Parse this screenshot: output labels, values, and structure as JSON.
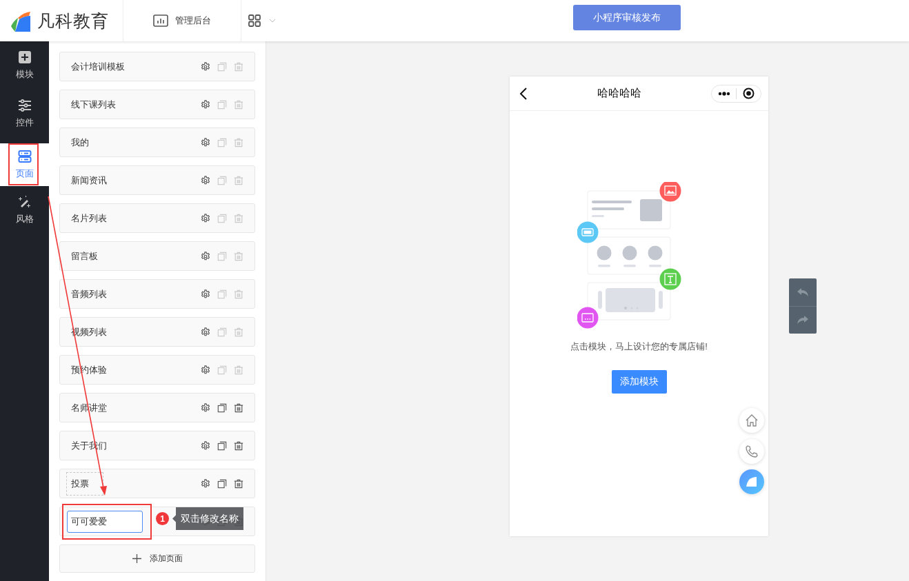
{
  "header": {
    "logo_text": "凡科教育",
    "nav": [
      {
        "label": "管理后台"
      }
    ],
    "publish_button": "小程序审核发布"
  },
  "sidebar": {
    "items": [
      {
        "label": "模块",
        "kind": "module",
        "selected": false
      },
      {
        "label": "控件",
        "kind": "control",
        "selected": false
      },
      {
        "label": "页面",
        "kind": "page",
        "selected": true
      },
      {
        "label": "风格",
        "kind": "style",
        "selected": false
      }
    ]
  },
  "pages": [
    {
      "name": "会计培训模板",
      "kind": "normal",
      "actions_disabled": true
    },
    {
      "name": "线下课列表",
      "kind": "normal",
      "actions_disabled": true
    },
    {
      "name": "我的",
      "kind": "normal",
      "actions_disabled": true
    },
    {
      "name": "新闻资讯",
      "kind": "normal",
      "actions_disabled": true
    },
    {
      "name": "名片列表",
      "kind": "normal",
      "actions_disabled": true
    },
    {
      "name": "留言板",
      "kind": "normal",
      "actions_disabled": true
    },
    {
      "name": "音频列表",
      "kind": "normal",
      "actions_disabled": true
    },
    {
      "name": "视频列表",
      "kind": "normal",
      "actions_disabled": true
    },
    {
      "name": "预约体验",
      "kind": "normal",
      "actions_disabled": true
    },
    {
      "name": "名师讲堂",
      "kind": "normal",
      "actions_disabled": false
    },
    {
      "name": "关于我们",
      "kind": "normal",
      "actions_disabled": false
    },
    {
      "name": "投票",
      "kind": "hover",
      "actions_disabled": false
    },
    {
      "name": "可可爱爱",
      "kind": "editing",
      "actions_disabled": false
    }
  ],
  "add_page_button": "添加页面",
  "phone": {
    "title": "哈哈哈哈",
    "empty_text": "点击模块，马上设计您的专属店铺!",
    "add_module_button": "添加模块"
  },
  "annotation": {
    "badge": "1",
    "tooltip": "双击修改名称"
  }
}
